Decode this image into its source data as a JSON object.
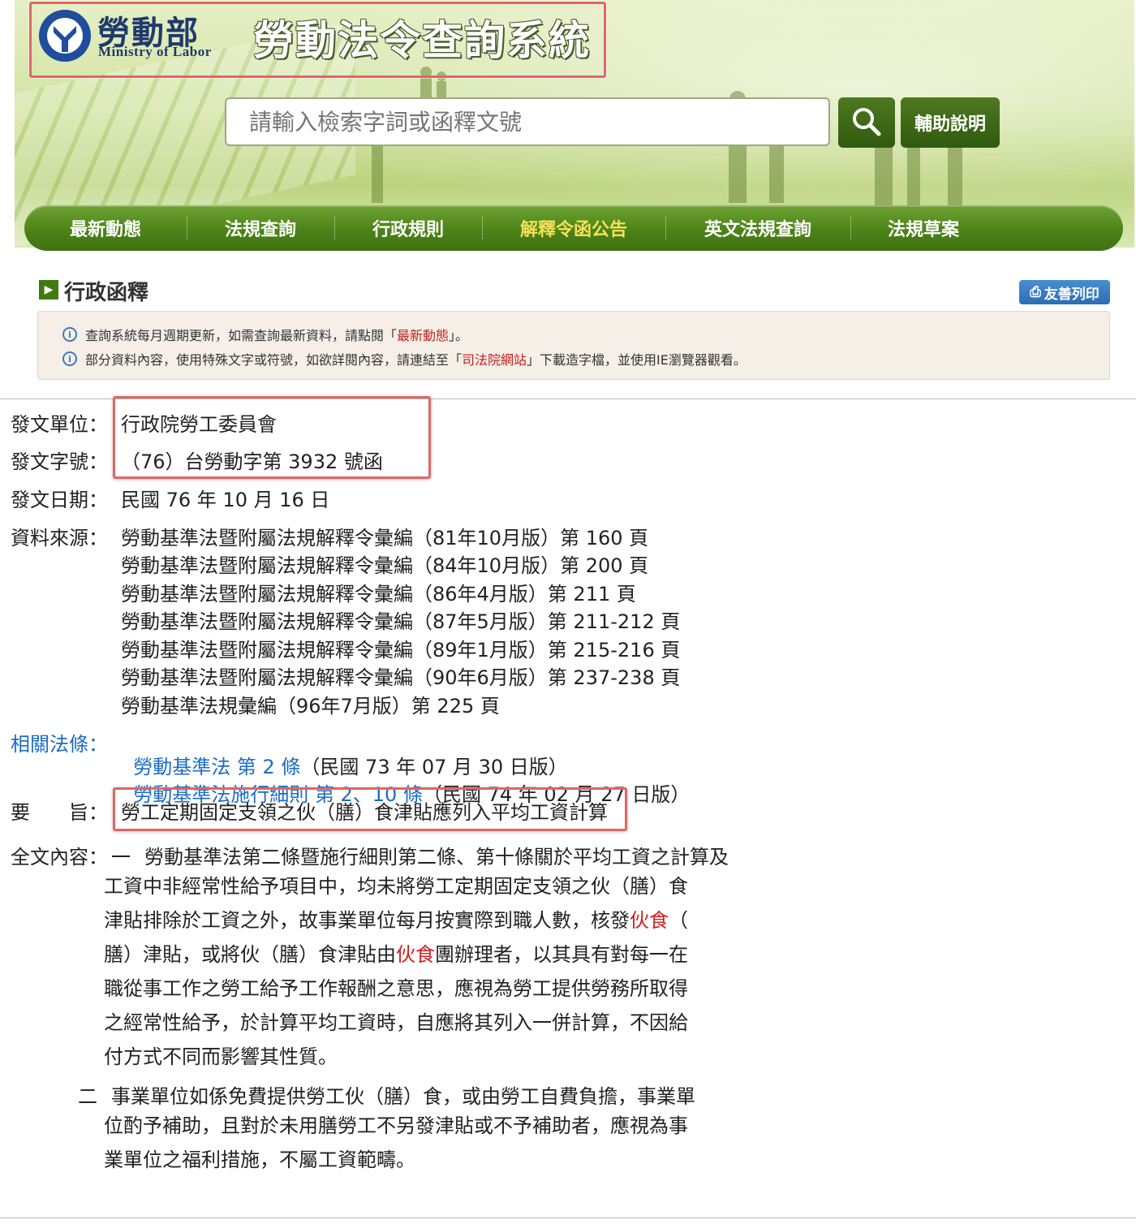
{
  "header": {
    "logo_zh": "勞動部",
    "logo_en": "Ministry of Labor",
    "site_title": "勞動法令查詢系統",
    "search_placeholder": "請輸入檢索字詞或函釋文號",
    "help_label": "輔助說明"
  },
  "nav": {
    "items": [
      "最新動態",
      "法規查詢",
      "行政規則",
      "解釋令函公告",
      "英文法規查詢",
      "法規草案"
    ],
    "active_index": 3
  },
  "section": {
    "title": "行政函釋",
    "print_label": "友善列印"
  },
  "notice": {
    "line1_prefix": "查詢系統每月週期更新，如需查詢最新資料，請點閱「",
    "line1_link": "最新動態",
    "line1_suffix": "」。",
    "line2_prefix": "部分資料內容，使用特殊文字或符號，如欲詳閱內容，請連結至「",
    "line2_link": "司法院網站",
    "line2_suffix": "」下載造字檔，並使用IE瀏覽器觀看。"
  },
  "detail": {
    "issuer_label": "發文單位：",
    "issuer": "行政院勞工委員會",
    "docno_label": "發文字號：",
    "docno": "（76）台勞動字第 3932 號函",
    "date_label": "發文日期：",
    "date": "民國 76 年 10 月 16 日",
    "source_label": "資料來源：",
    "sources": [
      "勞動基準法暨附屬法規解釋令彙編（81年10月版）第 160 頁",
      "勞動基準法暨附屬法規解釋令彙編（84年10月版）第 200 頁",
      "勞動基準法暨附屬法規解釋令彙編（86年4月版）第 211 頁",
      "勞動基準法暨附屬法規解釋令彙編（87年5月版）第 211-212 頁",
      "勞動基準法暨附屬法規解釋令彙編（89年1月版）第 215-216 頁",
      "勞動基準法暨附屬法規解釋令彙編（90年6月版）第 237-238 頁",
      "勞動基準法規彙編（96年7月版）第 225 頁"
    ],
    "related_label": "相關法條：",
    "related": [
      {
        "link": "勞動基準法 第 2 條",
        "note": "（民國 73 年 07 月 30 日版）"
      },
      {
        "link": "勞動基準法施行細則 第 2、10 條",
        "note": "（民國 74 年 02 月 27 日版）"
      }
    ],
    "gist_label": "要　　旨：",
    "gist": "勞工定期固定支領之伙（膳）食津貼應列入平均工資計算",
    "content_label": "全文內容：",
    "para1_num": "一",
    "para1_lines": [
      "勞動基準法第二條暨施行細則第二條、第十條關於平均工資之計算及",
      "工資中非經常性給予項目中，均未將勞工定期固定支領之伙（膳）食",
      "津貼排除於工資之外，故事業單位每月按實際到職人數，核發",
      "膳）津貼，或將伙（膳）食津貼由",
      "職從事工作之勞工給予工作報酬之意思，應視為勞工提供勞務所取得",
      "之經常性給予，於計算平均工資時，自應將其列入一併計算，不因給",
      "付方式不同而影響其性質。"
    ],
    "keyword": "伙食",
    "para1_line3_tail": "（",
    "para1_line4_tail": "團辦理者，以其具有對每一在",
    "para2_num": "二",
    "para2_lines": [
      "事業單位如係免費提供勞工伙（膳）食，或由勞工自費負擔，事業單",
      "位酌予補助，且對於未用膳勞工不另發津貼或不予補助者，應視為事",
      "業單位之福利措施，不屬工資範疇。"
    ]
  }
}
